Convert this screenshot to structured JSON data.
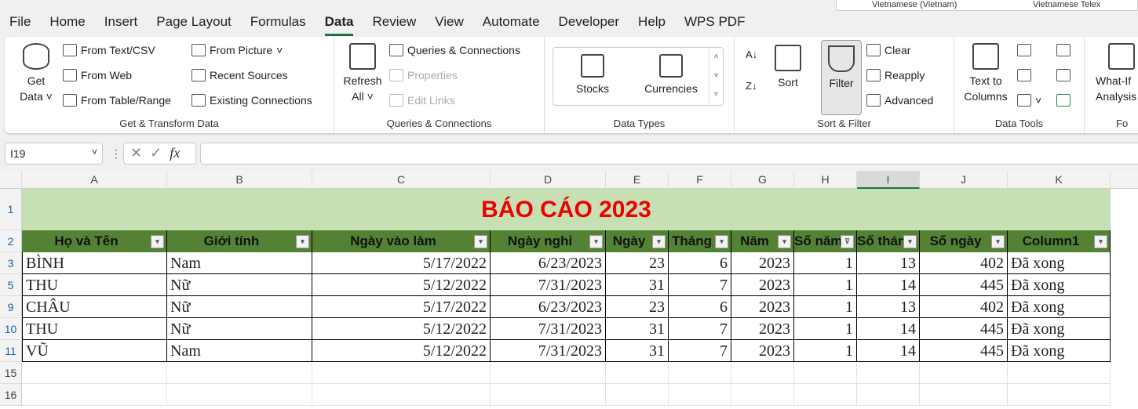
{
  "menu": [
    "File",
    "Home",
    "Insert",
    "Page Layout",
    "Formulas",
    "Data",
    "Review",
    "View",
    "Automate",
    "Developer",
    "Help",
    "WPS PDF"
  ],
  "active_tab": "Data",
  "popup": {
    "items": [
      "Vietnamese (Vietnam)",
      "Vietnamese Telex"
    ]
  },
  "ribbon": {
    "get_transform": {
      "get_data": "Get",
      "get_data2": "Data",
      "from_text": "From Text/CSV",
      "from_web": "From Web",
      "from_table": "From Table/Range",
      "from_picture": "From Picture",
      "recent": "Recent Sources",
      "existing": "Existing Connections",
      "label": "Get & Transform Data"
    },
    "queries": {
      "refresh": "Refresh",
      "refresh2": "All",
      "qc": "Queries & Connections",
      "properties": "Properties",
      "edit_links": "Edit Links",
      "label": "Queries & Connections"
    },
    "data_types": {
      "stocks": "Stocks",
      "currencies": "Currencies",
      "label": "Data Types"
    },
    "sort_filter": {
      "sort": "Sort",
      "filter": "Filter",
      "clear": "Clear",
      "reapply": "Reapply",
      "advanced": "Advanced",
      "label": "Sort & Filter"
    },
    "data_tools": {
      "text_to": "Text to",
      "columns": "Columns",
      "label": "Data Tools"
    },
    "forecast": {
      "whatif": "What-If",
      "analysis": "Analysis",
      "label": "Fo"
    }
  },
  "formula_bar": {
    "name_box": "I19",
    "fx": "fx",
    "value": ""
  },
  "columns": [
    "A",
    "B",
    "C",
    "D",
    "E",
    "F",
    "G",
    "H",
    "I",
    "J",
    "K"
  ],
  "selected_column": "I",
  "row_numbers": [
    "1",
    "2",
    "3",
    "5",
    "9",
    "10",
    "11",
    "15",
    "16"
  ],
  "title": "BÁO CÁO 2023",
  "headers": [
    "Họ và Tên",
    "Giới tính",
    "Ngày vào làm",
    "Ngày nghỉ",
    "Ngày",
    "Tháng",
    "Năm",
    "Số năm",
    "Số tháng",
    "Số ngày",
    "Column1"
  ],
  "filtered_column": "Số năm",
  "rows": [
    [
      "BÌNH",
      "Nam",
      "5/17/2022",
      "6/23/2023",
      "23",
      "6",
      "2023",
      "1",
      "13",
      "402",
      "Đã xong"
    ],
    [
      "THU",
      "Nữ",
      "5/12/2022",
      "7/31/2023",
      "31",
      "7",
      "2023",
      "1",
      "14",
      "445",
      "Đã xong"
    ],
    [
      "CHÂU",
      "Nữ",
      "5/17/2022",
      "6/23/2023",
      "23",
      "6",
      "2023",
      "1",
      "13",
      "402",
      "Đã xong"
    ],
    [
      "THU",
      "Nữ",
      "5/12/2022",
      "7/31/2023",
      "31",
      "7",
      "2023",
      "1",
      "14",
      "445",
      "Đã xong"
    ],
    [
      "VŨ",
      "Nam",
      "5/12/2022",
      "7/31/2023",
      "31",
      "7",
      "2023",
      "1",
      "14",
      "445",
      "Đã xong"
    ]
  ],
  "colors": {
    "header_fill": "#548235",
    "title_fill": "#c6e0b4",
    "title_text": "#ff0000",
    "accent": "#1e7145"
  }
}
